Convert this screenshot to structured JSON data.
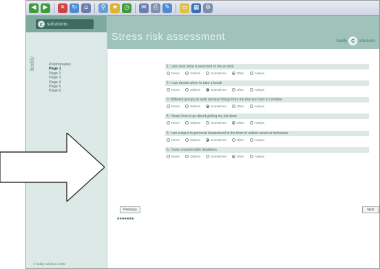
{
  "brand": {
    "chip_text": "solutions",
    "chip_letter": "c",
    "vertical_text": "bodily",
    "header_word": "bodily",
    "header_word2": "solutions",
    "header_letter": "c"
  },
  "page_title": "Stress risk assessment",
  "sidebar": {
    "nav": [
      "Preliminaries",
      "Page 1",
      "Page 2",
      "Page 3",
      "Page 4",
      "Page 5",
      "Page 6"
    ],
    "active_index": 1,
    "footer": "© bodily solutions 2005"
  },
  "options": [
    "Never",
    "Seldom",
    "Sometimes",
    "Often",
    "Always"
  ],
  "questions": [
    {
      "label": "1. I am clear what is expected of me at work",
      "selected": "Often"
    },
    {
      "label": "2. I can decide when to take a break",
      "selected": "Sometimes"
    },
    {
      "label": "3. Different groups at work demand things from me that are hard to combine",
      "selected": "Sometimes"
    },
    {
      "label": "4. I know how to go about getting my job done",
      "selected": "Often"
    },
    {
      "label": "5. I am subject to personal harassment in the form of unkind words or behaviour",
      "selected": "Sometimes"
    },
    {
      "label": "6. I have unachievable deadlines",
      "selected": "Often"
    }
  ],
  "buttons": {
    "previous": "Previous",
    "next": "Next"
  },
  "progress_label": "■■■■■■■",
  "colors": {
    "header": "#9fc3ba",
    "sidebar": "#dce9e6",
    "question_bar": "#dbe8e5"
  }
}
